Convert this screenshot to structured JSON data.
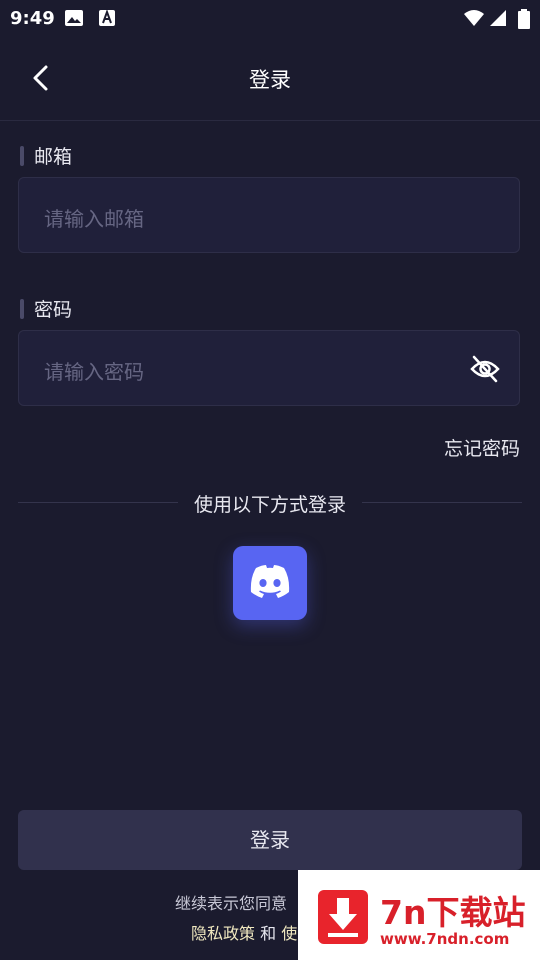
{
  "status_bar": {
    "time": "9:49"
  },
  "header": {
    "title": "登录"
  },
  "email": {
    "label": "邮箱",
    "placeholder": "请输入邮箱"
  },
  "password": {
    "label": "密码",
    "placeholder": "请输入密码"
  },
  "forgot_password": "忘记密码",
  "alt_login": {
    "text": "使用以下方式登录",
    "providers": [
      "discord"
    ]
  },
  "login_button": "登录",
  "terms": {
    "line1": "继续表示您同意",
    "privacy": "隐私政策",
    "and": " 和 ",
    "terms_prefix": "使"
  },
  "watermark": {
    "brand": "7n下载站",
    "url": "www.7ndn.com"
  },
  "colors": {
    "background": "#1b1b2e",
    "discord": "#5865f2",
    "watermark_red": "#e8242c"
  },
  "icons": [
    "back-arrow-icon",
    "eye-off-icon",
    "discord-icon",
    "image-icon",
    "a-icon",
    "wifi-icon",
    "signal-icon",
    "battery-icon"
  ]
}
